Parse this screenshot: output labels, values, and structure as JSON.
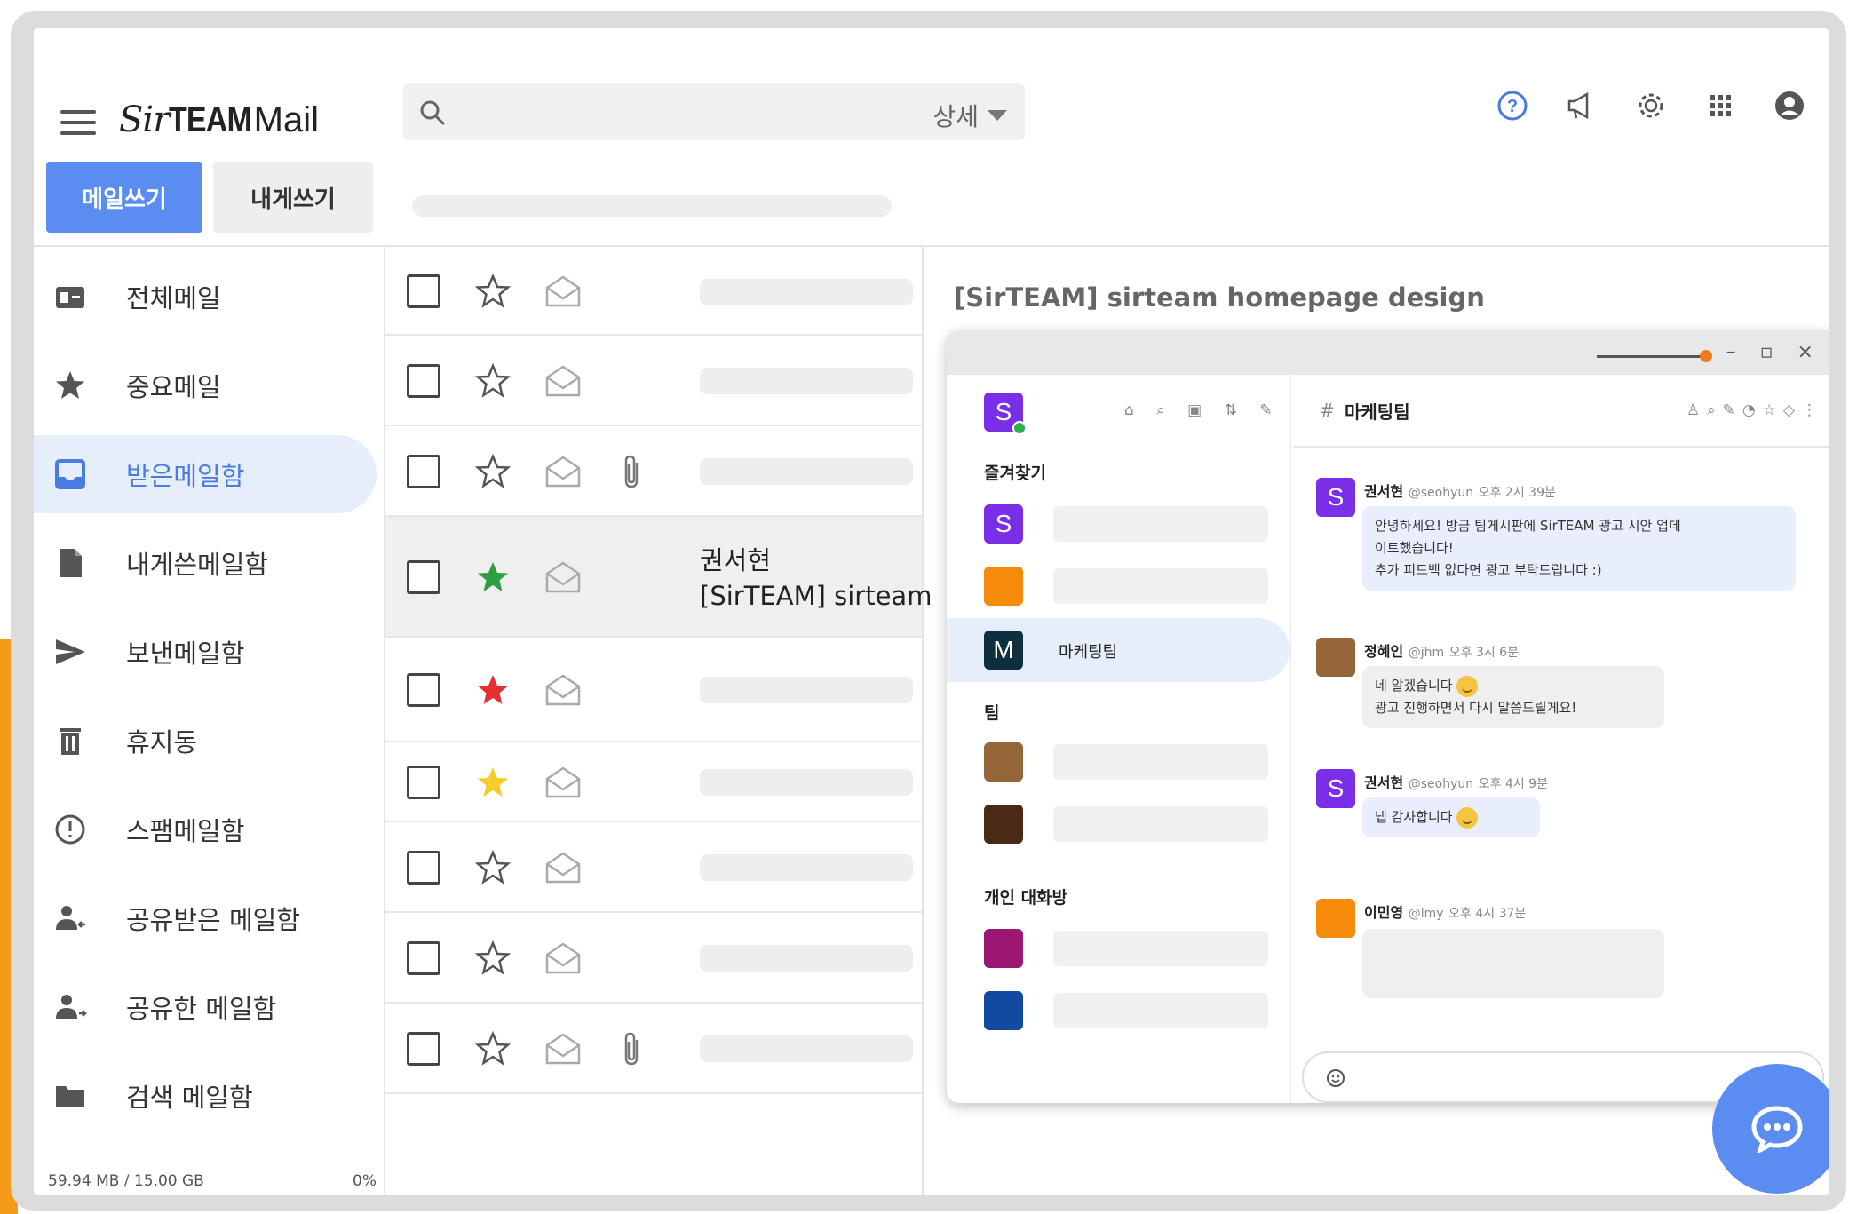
{
  "app": {
    "logo_sir": "Sir",
    "logo_team": "TEAM",
    "logo_mail": " Mail"
  },
  "search": {
    "advanced_label": "상세"
  },
  "toolbar": {
    "compose_label": "메일쓰기",
    "self_compose_label": "내게쓰기"
  },
  "sidebar": {
    "items": [
      {
        "label": "전체메일",
        "icon": "all-mail-icon"
      },
      {
        "label": "중요메일",
        "icon": "star-icon"
      },
      {
        "label": "받은메일함",
        "icon": "inbox-icon"
      },
      {
        "label": "내게쓴메일함",
        "icon": "document-icon"
      },
      {
        "label": "보낸메일함",
        "icon": "send-icon"
      },
      {
        "label": "휴지동",
        "icon": "trash-icon"
      },
      {
        "label": "스팸메일함",
        "icon": "alert-icon"
      },
      {
        "label": "공유받은 메일함",
        "icon": "shared-in-icon"
      },
      {
        "label": "공유한 메일함",
        "icon": "shared-out-icon"
      },
      {
        "label": "검색 메일함",
        "icon": "folder-icon"
      }
    ],
    "storage_used": "59.94 MB / 15.00 GB",
    "storage_percent": "0%"
  },
  "mail_list": {
    "selected_sender": "권서현",
    "selected_subject": "[SirTEAM] sirteam"
  },
  "preview": {
    "title": "[SirTEAM] sirteam homepage design"
  },
  "messenger": {
    "workspace_initial": "S",
    "favorites_label": "즐겨찾기",
    "team_label": "팀",
    "dm_label": "개인 대화방",
    "marketing_initial": "M",
    "marketing_name": "마케팅팀",
    "channel_title": "마케팅팀",
    "messages": [
      {
        "name": "권서현",
        "handle": "@seohyun",
        "time": "오후 2시 39분",
        "lines": [
          "안녕하세요! 방금 팀게시판에 SirTEAM 광고 시안 업데",
          "이트했습니다!",
          "추가 피드백 없다면 광고 부탁드립니다 :)"
        ]
      },
      {
        "name": "정혜인",
        "handle": "@jhm",
        "time": "오후 3시 6분",
        "lines": [
          "네 알겠습니다",
          "광고 진행하면서 다시 말씀드릴게요!"
        ]
      },
      {
        "name": "권서현",
        "handle": "@seohyun",
        "time": "오후 4시 9분",
        "lines": [
          "넵 감사합니다"
        ]
      },
      {
        "name": "이민영",
        "handle": "@lmy",
        "time": "오후 4시 37분",
        "lines": []
      }
    ]
  },
  "colors": {
    "accent": "#5b8cf0",
    "orange": "#f59a19",
    "star_green": "#2e9e3e",
    "star_red": "#e53030",
    "star_yellow": "#f5cc2a",
    "purple": "#7a2ee8"
  }
}
